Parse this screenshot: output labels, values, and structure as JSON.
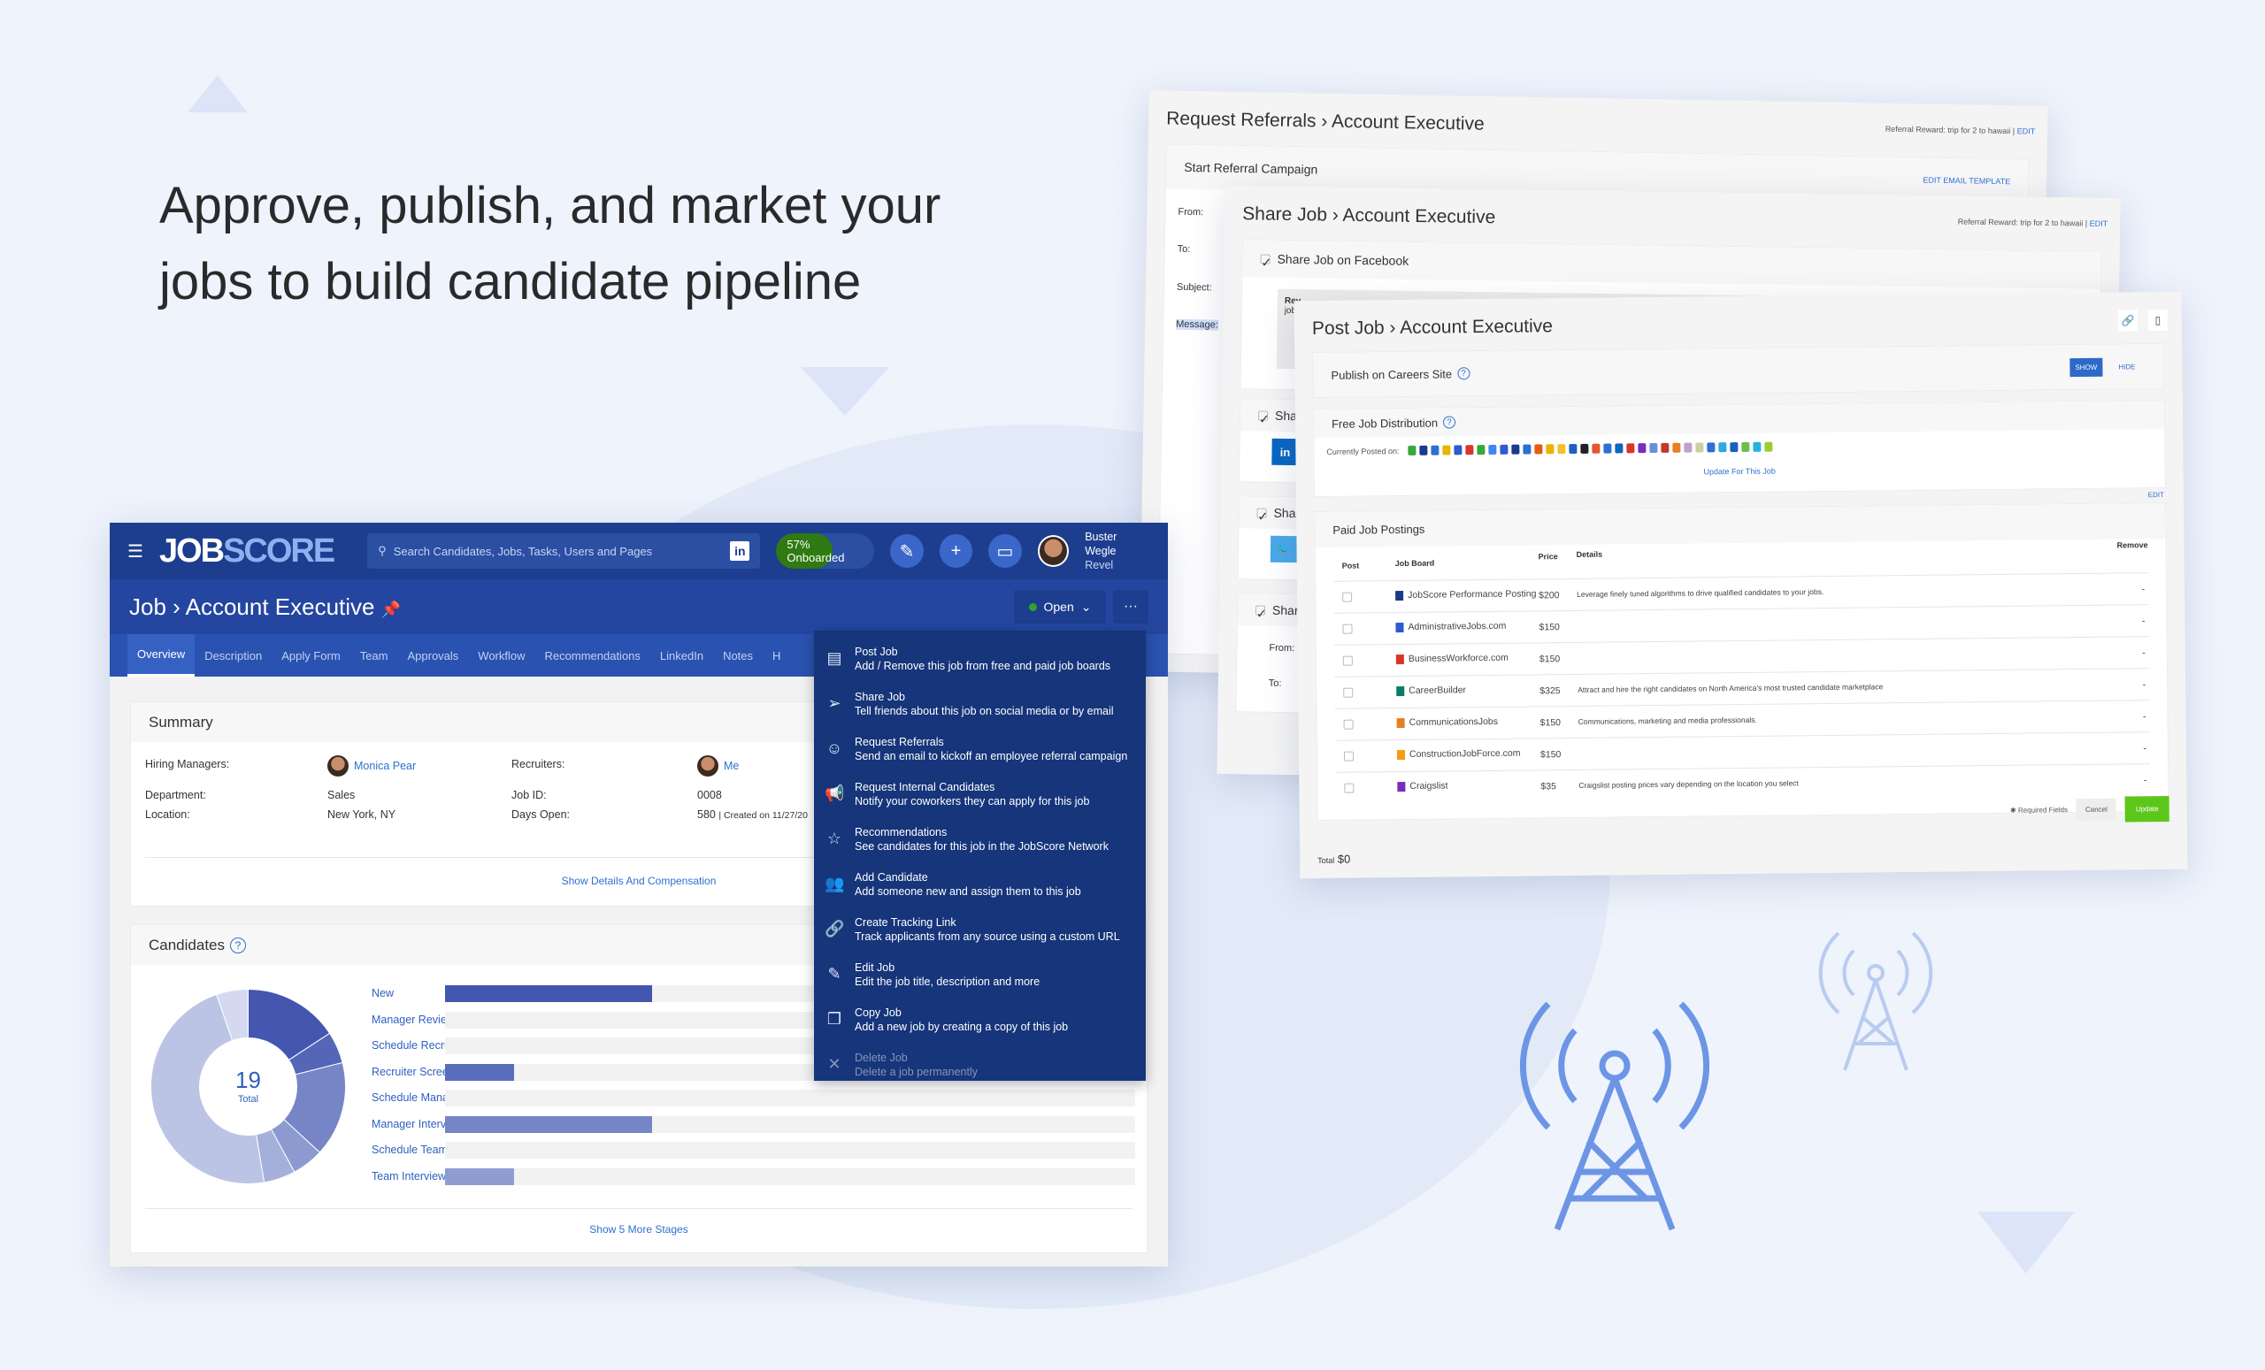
{
  "headline": {
    "line1": "Approve, publish, and market your",
    "line2": "jobs to build candidate pipeline"
  },
  "colors": {
    "nav": "#1d3e8e",
    "header": "#2446a0",
    "tabs": "#2a52b0",
    "dropdown": "#16357a",
    "link": "#2f6fd0",
    "update": "#5cc71a",
    "onboarded": "#2f7a12"
  },
  "app": {
    "logo": {
      "a": "JOB",
      "b": "SCORE"
    },
    "search_placeholder": "Search Candidates, Jobs, Tasks, Users and Pages",
    "linkedin_label": "in",
    "onboarded": {
      "label": "57% Onboarded",
      "percent": 57
    },
    "nav_icons": [
      "wand-icon",
      "plus-icon",
      "chat-icon"
    ],
    "user": {
      "name": "Buster Wegle",
      "org": "Revel"
    },
    "breadcrumb": {
      "root": "Job",
      "sep": "›",
      "current": "Account Executive"
    },
    "status": "Open",
    "more": "···",
    "tabs": [
      "Overview",
      "Description",
      "Apply Form",
      "Team",
      "Approvals",
      "Workflow",
      "Recommendations",
      "LinkedIn",
      "Notes",
      "H"
    ],
    "summary": {
      "title": "Summary",
      "hiring_managers_label": "Hiring Managers:",
      "hiring_manager": "Monica Pear",
      "recruiters_label": "Recruiters:",
      "recruiter": "Me",
      "department_label": "Department:",
      "department": "Sales",
      "location_label": "Location:",
      "location": "New York, NY",
      "job_id_label": "Job ID:",
      "job_id": "0008",
      "days_open_label": "Days Open:",
      "days_open": "580",
      "created": "| Created on 11/27/20",
      "show_details": "Show Details And Compensation"
    },
    "candidates": {
      "title": "Candidates",
      "total": "19",
      "total_label": "Total",
      "stages": [
        {
          "name": "New",
          "count": 3,
          "color": "#4556b0"
        },
        {
          "name": "Manager Review",
          "count": 0,
          "color": "#5566b8"
        },
        {
          "name": "Schedule Recruiter Screen",
          "count": 0,
          "color": "#5566b8"
        },
        {
          "name": "Recruiter Screen",
          "count": 1,
          "color": "#5a6cbc"
        },
        {
          "name": "Schedule Manager Interview",
          "count": 0,
          "color": "#7585c6"
        },
        {
          "name": "Manager Interview",
          "count": 3,
          "color": "#7585c6"
        },
        {
          "name": "Schedule Team Interview",
          "count": 0,
          "color": "#8c9acf"
        },
        {
          "name": "Team Interview",
          "count": 1,
          "color": "#8f9cd1"
        }
      ],
      "bar_max": 10,
      "donut": [
        {
          "value": 3,
          "color": "#4556b0"
        },
        {
          "value": 1,
          "color": "#5566b8"
        },
        {
          "value": 3,
          "color": "#7585c6"
        },
        {
          "value": 1,
          "color": "#8c9acf"
        },
        {
          "value": 1,
          "color": "#a5b0da"
        },
        {
          "value": 9,
          "color": "#bcc4e6"
        },
        {
          "value": 1,
          "color": "#d4d9f0"
        }
      ],
      "show_more": "Show 5 More Stages"
    }
  },
  "dropdown": [
    {
      "icon": "rss-doc-icon",
      "glyph": "▤",
      "title": "Post Job",
      "desc": "Add / Remove this job from free and paid job boards"
    },
    {
      "icon": "paper-plane-icon",
      "glyph": "➢",
      "title": "Share Job",
      "desc": "Tell friends about this job on social media or by email"
    },
    {
      "icon": "referral-icon",
      "glyph": "☺",
      "title": "Request Referrals",
      "desc": "Send an email to kickoff an employee referral campaign"
    },
    {
      "icon": "megaphone-icon",
      "glyph": "📢",
      "title": "Request Internal Candidates",
      "desc": "Notify your coworkers they can apply for this job"
    },
    {
      "icon": "star-icon",
      "glyph": "☆",
      "title": "Recommendations",
      "desc": "See candidates for this job in the JobScore Network"
    },
    {
      "icon": "users-icon",
      "glyph": "👥",
      "title": "Add Candidate",
      "desc": "Add someone new and assign them to this job"
    },
    {
      "icon": "link-icon",
      "glyph": "🔗",
      "title": "Create Tracking Link",
      "desc": "Track applicants from any source using a custom URL"
    },
    {
      "icon": "pencil-icon",
      "glyph": "✎",
      "title": "Edit Job",
      "desc": "Edit the job title, description and more"
    },
    {
      "icon": "copy-icon",
      "glyph": "❐",
      "title": "Copy Job",
      "desc": "Add a new job by creating a copy of this job"
    },
    {
      "icon": "x-icon",
      "glyph": "✕",
      "title": "Delete Job",
      "desc": "Delete a job permanently",
      "disabled": true
    }
  ],
  "referrals": {
    "title_root": "Request Referrals",
    "title_job": "Account Executive",
    "reward": "Referral Reward: trip for 2 to hawaii |",
    "edit": "EDIT",
    "section": "Start Referral Campaign",
    "edit_template": "EDIT EMAIL TEMPLATE",
    "fields": [
      "From:",
      "To:",
      "Subject:",
      "Message:"
    ]
  },
  "share": {
    "title_root": "Share Job",
    "title_job": "Account Executive",
    "reward": "Referral Reward: trip for 2 to hawaii |",
    "edit": "EDIT",
    "facebook": "Share Job on Facebook",
    "preview": "Rev",
    "preview2": "jobs",
    "share_partial": "Shar",
    "from": "From:",
    "to": "To:",
    "linkedin": "in",
    "twitter": "🐦"
  },
  "post": {
    "title_root": "Post Job",
    "title_job": "Account Executive",
    "careers": "Publish on Careers Site",
    "show": "SHOW",
    "hide": "HIDE",
    "free": "Free Job Distribution",
    "posted_on": "Currently Posted on:",
    "board_colors": [
      "#3aa838",
      "#1a3a8a",
      "#2f6fd0",
      "#e8b400",
      "#2d5bd0",
      "#d9362b",
      "#3aa838",
      "#4285f4",
      "#2d5bd0",
      "#1a3a8a",
      "#2f6fd0",
      "#e45b12",
      "#e8b400",
      "#f2c12e",
      "#1f5fbf",
      "#222",
      "#e4572e",
      "#2f6fd0",
      "#0a66c2",
      "#d9362b",
      "#7a2bbf",
      "#6b8de0",
      "#c0392b",
      "#e67e22",
      "#c0a0d0",
      "#c7d2a0",
      "#2f6fd0",
      "#2fa8e0",
      "#1a5fbf",
      "#6bc04b",
      "#2ab0e0",
      "#9acd32"
    ],
    "update_link": "Update For This Job",
    "paid": "Paid Job Postings",
    "paid_edit": "EDIT",
    "headers": {
      "post": "Post",
      "board": "Job Board",
      "price": "Price",
      "details": "Details",
      "remove": "Remove"
    },
    "rows": [
      {
        "board": "JobScore Performance Posting",
        "price": "$200",
        "details": "Leverage finely tuned algorithms to drive qualified candidates to your jobs.",
        "color": "#1a3a8a"
      },
      {
        "board": "AdministrativeJobs.com",
        "price": "$150",
        "details": "",
        "color": "#2d5bd0"
      },
      {
        "board": "BusinessWorkforce.com",
        "price": "$150",
        "details": "",
        "color": "#d9362b"
      },
      {
        "board": "CareerBuilder",
        "price": "$325",
        "details": "Attract and hire the right candidates on North America's most trusted candidate marketplace",
        "color": "#0a7d6a"
      },
      {
        "board": "CommunicationsJobs",
        "price": "$150",
        "details": "Communications, marketing and media professionals.",
        "color": "#e67e22"
      },
      {
        "board": "ConstructionJobForce.com",
        "price": "$150",
        "details": "",
        "color": "#f39c12"
      },
      {
        "board": "Craigslist",
        "price": "$35",
        "details": "Craigslist posting prices vary depending on the location you select",
        "color": "#7a2bbf"
      }
    ],
    "remove_mark": "-",
    "required": "✱ Required Fields",
    "cancel": "Cancel",
    "update": "Update",
    "total_label": "Total",
    "total": "$0"
  }
}
